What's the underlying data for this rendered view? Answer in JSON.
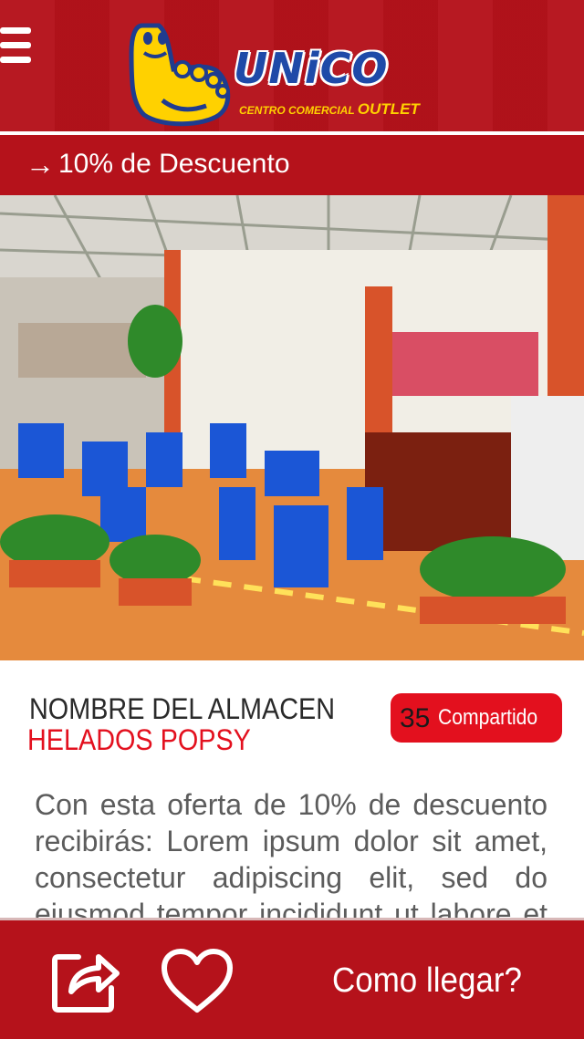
{
  "header": {
    "menu_icon": "hamburger-menu-icon",
    "logo": {
      "brand": "UNiCO",
      "tagline_prefix": "CENTRO COMERCIAL",
      "tagline_suffix": "OUTLET"
    }
  },
  "promo": {
    "arrow": "→",
    "text": "10% de Descuento"
  },
  "store": {
    "title": "NOMBRE DEL ALMACEN",
    "name": "HELADOS POPSY",
    "share_count": "35",
    "share_label": "Compartido"
  },
  "description": "Con esta oferta de 10% de descuento recibirás: Lorem ipsum dolor sit amet, consectetur adipiscing elit, sed do eiusmod tempor incididunt ut labore et ut",
  "footer": {
    "share_icon": "share-icon",
    "heart_icon": "heart-icon",
    "directions_label": "Como llegar?"
  },
  "colors": {
    "primary_red": "#b5121b",
    "accent_red": "#e3101e",
    "logo_blue": "#1f4aa8",
    "logo_yellow": "#ffd100"
  }
}
